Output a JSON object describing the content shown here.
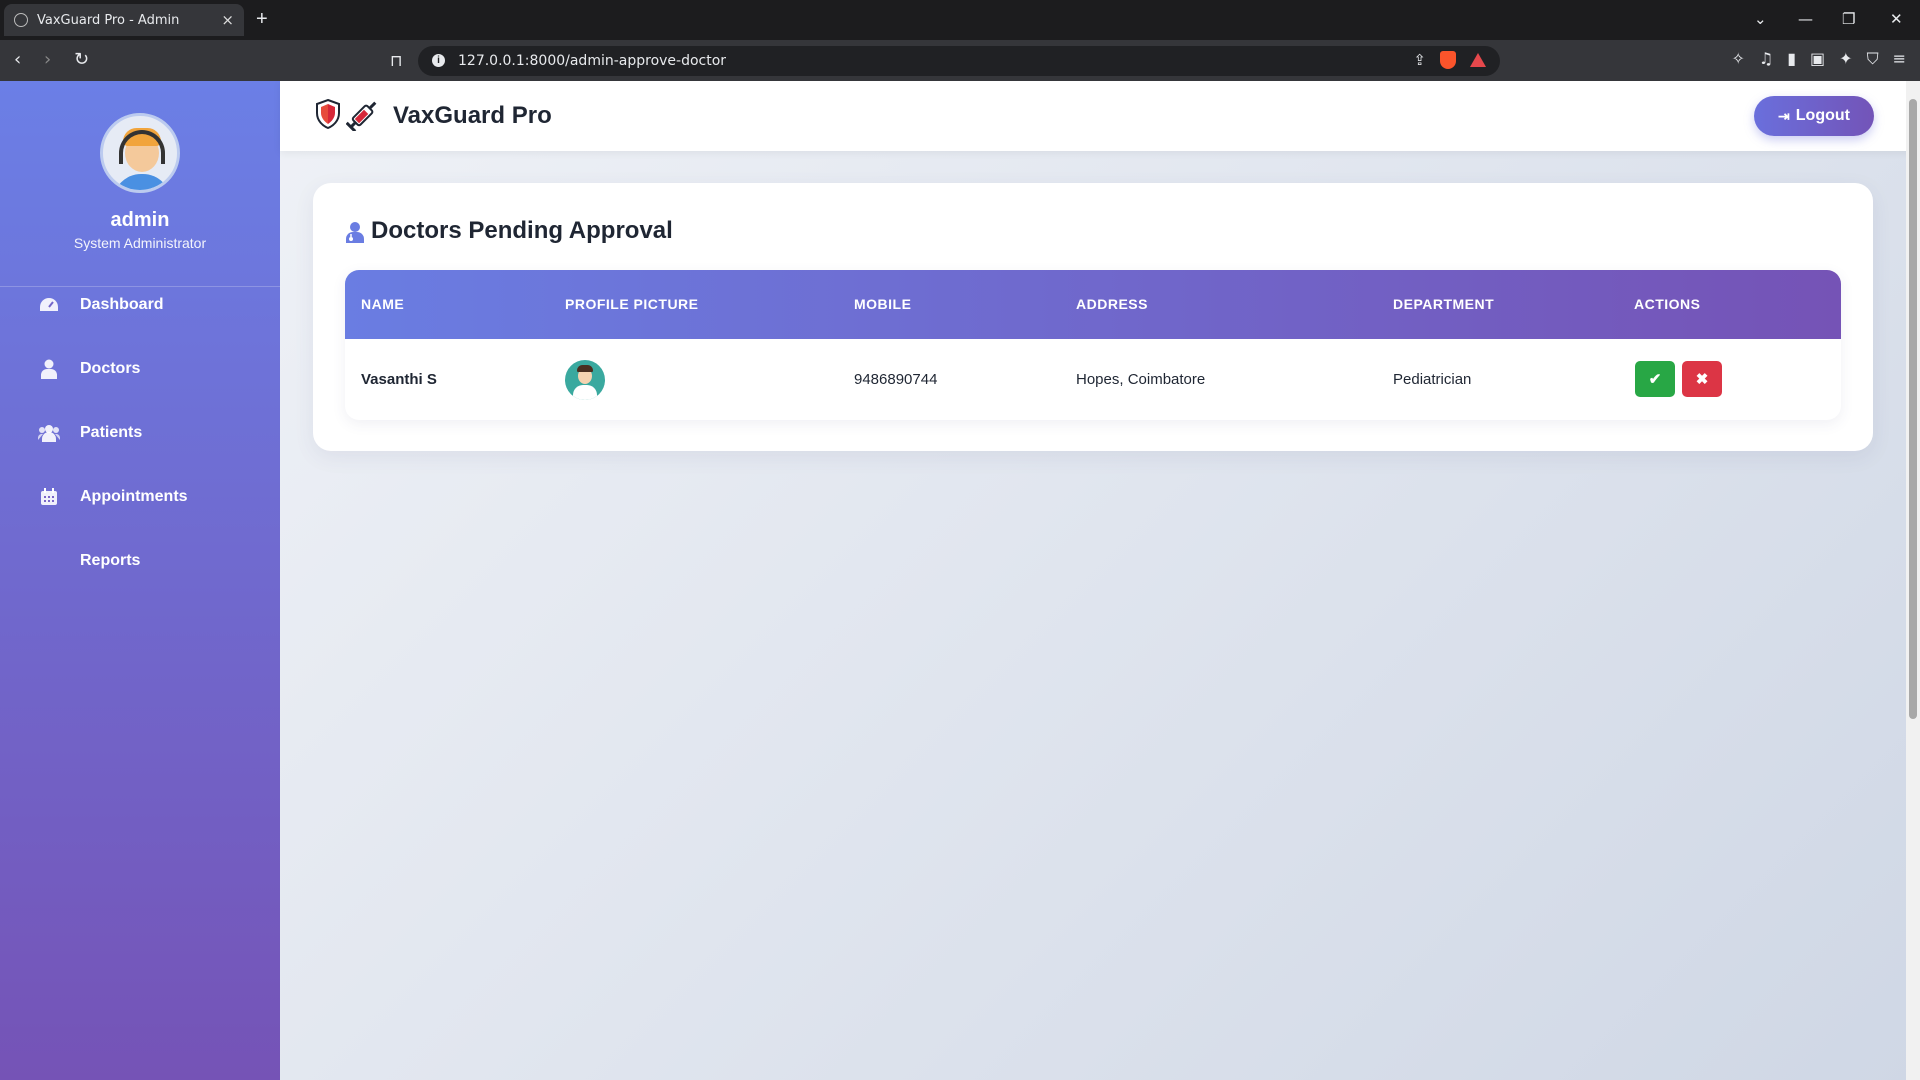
{
  "browser": {
    "tab_title": "VaxGuard Pro - Admin",
    "tab_close": "×",
    "new_tab": "+",
    "url": "127.0.0.1:8000/admin-approve-doctor"
  },
  "sidebar": {
    "user_name": "admin",
    "user_role": "System Administrator",
    "items": [
      {
        "label": "Dashboard",
        "icon": "dashboard-icon"
      },
      {
        "label": "Doctors",
        "icon": "doctor-icon"
      },
      {
        "label": "Patients",
        "icon": "users-icon"
      },
      {
        "label": "Appointments",
        "icon": "calendar-icon"
      },
      {
        "label": "Reports",
        "icon": ""
      }
    ]
  },
  "header": {
    "brand": "VaxGuard Pro",
    "logout_label": "Logout"
  },
  "main": {
    "title": "Doctors Pending Approval",
    "columns": [
      "NAME",
      "PROFILE PICTURE",
      "MOBILE",
      "ADDRESS",
      "DEPARTMENT",
      "ACTIONS"
    ],
    "rows": [
      {
        "name": "Vasanthi S",
        "mobile": "9486890744",
        "address": "Hopes, Coimbatore",
        "department": "Pediatrician"
      }
    ]
  },
  "colors": {
    "accent": "#6a6fdc",
    "sidebar_top": "#6b7fe6",
    "sidebar_bottom": "#7553b6",
    "approve": "#28a745",
    "reject": "#dc3545"
  }
}
